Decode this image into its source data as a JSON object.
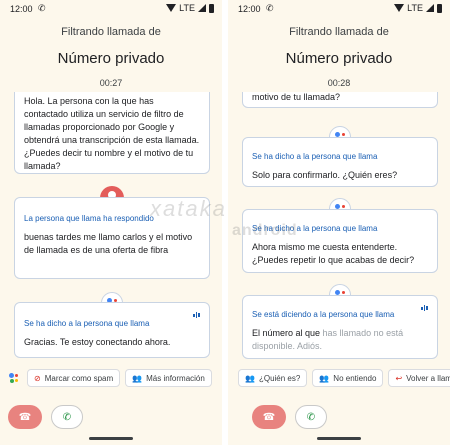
{
  "left": {
    "status": {
      "time": "12:00",
      "network": "LTE"
    },
    "header": {
      "subtitle": "Filtrando llamada de",
      "caller": "Número privado",
      "timer": "00:27"
    },
    "cards": [
      {
        "label": "",
        "text": "Hola. La persona con la que has contactado utiliza un servicio de filtro de llamadas proporcionado por Google y obtendrá una transcripción de esta llamada. ¿Puedes decir tu nombre y el motivo de tu llamada?"
      },
      {
        "label": "La persona que llama ha respondido",
        "text": "buenas tardes me llamo carlos y el motivo de llamada es de una oferta de fibra"
      },
      {
        "label": "Se ha dicho a la persona que llama",
        "text": "Gracias. Te estoy conectando ahora."
      }
    ],
    "chips": [
      "Marcar como spam",
      "Más información"
    ]
  },
  "right": {
    "status": {
      "time": "12:00",
      "network": "LTE"
    },
    "header": {
      "subtitle": "Filtrando llamada de",
      "caller": "Número privado",
      "timer": "00:28"
    },
    "cards": [
      {
        "label": "",
        "text": "motivo de tu llamada?"
      },
      {
        "label": "Se ha dicho a la persona que llama",
        "text": "Solo para confirmarlo. ¿Quién eres?"
      },
      {
        "label": "Se ha dicho a la persona que llama",
        "text": "Ahora mismo me cuesta entenderte. ¿Puedes repetir lo que acabas de decir?"
      },
      {
        "label": "Se está diciendo a la persona que llama",
        "text_main": "El número al que ",
        "text_faded": "has llamado no está disponible. Adiós."
      }
    ],
    "chips": [
      "¿Quién es?",
      "No entiendo",
      "Volver a llam"
    ]
  },
  "watermark": {
    "part1": "xataka",
    "part2": "android"
  },
  "colors": {
    "accent": "#1a5fb4",
    "end_call": "#e8837f",
    "answer": "#1e8e3e",
    "background": "#fdf8ec",
    "avatar": "#e35d5b"
  }
}
